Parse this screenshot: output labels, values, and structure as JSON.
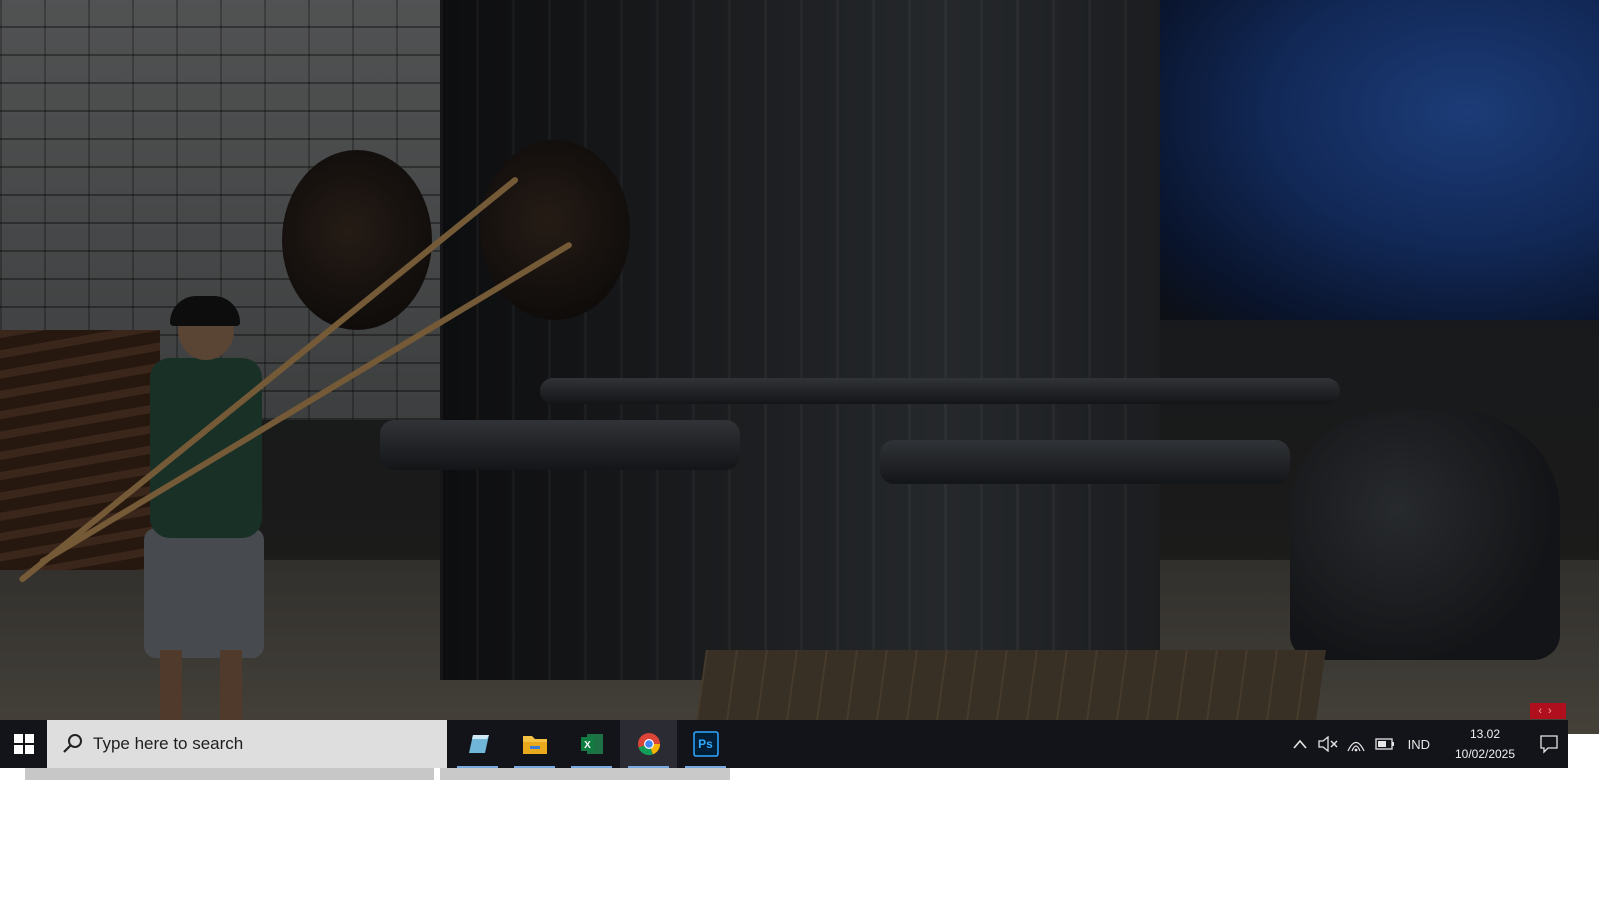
{
  "desktop": {
    "wallpaper": "photo-boiler-room"
  },
  "taskbar": {
    "start_icon": "windows-logo-icon",
    "search": {
      "placeholder": "Type here to search",
      "icon": "search-icon"
    },
    "apps": [
      {
        "name": "notepad-app",
        "icon": "notepad-icon",
        "active": false
      },
      {
        "name": "file-explorer-app",
        "icon": "folder-icon",
        "active": false
      },
      {
        "name": "excel-app",
        "icon": "excel-icon",
        "active": false
      },
      {
        "name": "chrome-app",
        "icon": "chrome-icon",
        "active": true
      },
      {
        "name": "photoshop-app",
        "icon": "photoshop-icon",
        "label": "Ps",
        "active": false
      }
    ],
    "tray": {
      "chevron_icon": "chevron-up-icon",
      "volume_icon": "volume-muted-icon",
      "wifi_icon": "wifi-icon",
      "battery_icon": "battery-icon",
      "language": "IND",
      "time": "13.02",
      "date": "10/02/2025",
      "notification_icon": "notification-icon"
    }
  },
  "colors": {
    "taskbar_bg": "#13131a",
    "search_bg": "#dedede",
    "active_app_bg": "#2b2b33",
    "accent": "#7aa8e0",
    "edge_button": "#b0101e"
  }
}
